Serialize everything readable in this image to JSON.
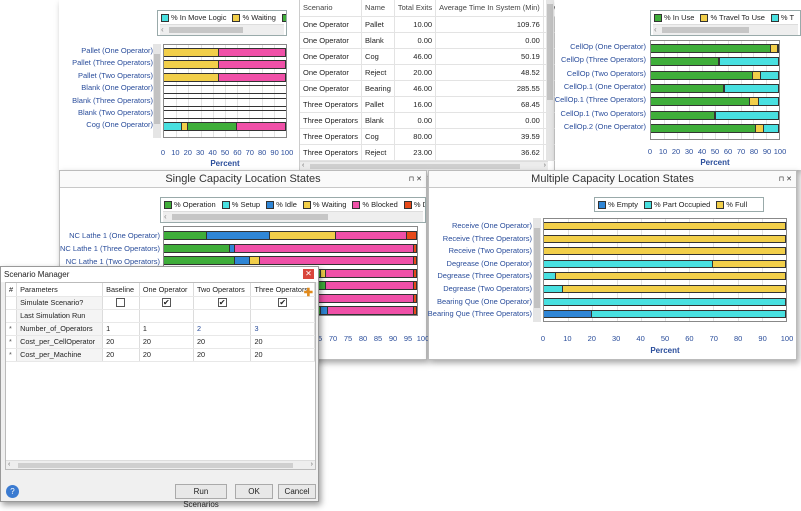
{
  "top_left": {
    "legend": [
      {
        "label": "% In Move Logic",
        "color": "#48e0e0"
      },
      {
        "label": "% Waiting",
        "color": "#f2cf4a"
      },
      {
        "label": "",
        "color": "#3fae3a"
      }
    ],
    "categories": [
      "Pallet (One Operator)",
      "Pallet (Three Operators)",
      "Pallet (Two Operators)",
      "Blank (One Operator)",
      "Blank (Three Operators)",
      "Blank (Two Operators)",
      "Cog (One Operator)"
    ],
    "x_ticks": [
      "0",
      "10",
      "20",
      "30",
      "40",
      "50",
      "60",
      "70",
      "80",
      "90",
      "100"
    ],
    "xlabel": "Percent"
  },
  "table": {
    "headers": [
      "Scenario",
      "Name",
      "Total Exits",
      "Average Time In System (Min)",
      "Average"
    ],
    "rows": [
      [
        "One Operator",
        "Pallet",
        "10.00",
        "109.76"
      ],
      [
        "One Operator",
        "Blank",
        "0.00",
        "0.00"
      ],
      [
        "One Operator",
        "Cog",
        "46.00",
        "50.19"
      ],
      [
        "One Operator",
        "Reject",
        "20.00",
        "48.52"
      ],
      [
        "One Operator",
        "Bearing",
        "46.00",
        "285.55"
      ],
      [
        "Three Operators",
        "Pallet",
        "16.00",
        "68.45"
      ],
      [
        "Three Operators",
        "Blank",
        "0.00",
        "0.00"
      ],
      [
        "Three Operators",
        "Cog",
        "80.00",
        "39.59"
      ],
      [
        "Three Operators",
        "Reject",
        "23.00",
        "36.62"
      ],
      [
        "Three Operators",
        "Bearing",
        "79.00",
        "37.92"
      ]
    ]
  },
  "top_right": {
    "legend": [
      {
        "label": "% In Use",
        "color": "#3fae3a"
      },
      {
        "label": "% Travel To Use",
        "color": "#f2cf4a"
      },
      {
        "label": "% T",
        "color": "#48e0e0"
      }
    ],
    "categories": [
      "CellOp (One Operator)",
      "CellOp (Three Operators)",
      "CellOp (Two Operators)",
      "CellOp.1 (One Operator)",
      "CellOp.1 (Three Operators)",
      "CellOp.1 (Two Operators)",
      "CellOp.2 (One Operator)"
    ],
    "x_ticks": [
      "0",
      "10",
      "20",
      "30",
      "40",
      "50",
      "60",
      "70",
      "80",
      "90",
      "100"
    ],
    "xlabel": "Percent"
  },
  "single": {
    "title": "Single Capacity Location States",
    "controls": "⊓ ✕",
    "legend": [
      {
        "label": "% Operation",
        "color": "#3fae3a"
      },
      {
        "label": "% Setup",
        "color": "#48e0e0"
      },
      {
        "label": "% Idle",
        "color": "#2f86d6"
      },
      {
        "label": "% Waiting",
        "color": "#f2cf4a"
      },
      {
        "label": "% Blocked",
        "color": "#f050a8"
      },
      {
        "label": "% Do",
        "color": "#e84a1a"
      }
    ],
    "categories": [
      "NC Lathe 1 (One Operator)",
      "NC Lathe 1 (Three Operators)",
      "NC Lathe 1 (Two Operators)"
    ],
    "x_ticks": [
      "65",
      "70",
      "75",
      "80",
      "85",
      "90",
      "95",
      "100"
    ]
  },
  "multi": {
    "title": "Multiple Capacity Location States",
    "controls": "⊓ ✕",
    "legend": [
      {
        "label": "% Empty",
        "color": "#2f86d6"
      },
      {
        "label": "% Part Occupied",
        "color": "#48e0e0"
      },
      {
        "label": "% Full",
        "color": "#f2cf4a"
      }
    ],
    "categories": [
      "Receive (One Operator)",
      "Receive (Three Operators)",
      "Receive (Two Operators)",
      "Degrease (One Operator)",
      "Degrease (Three Operators)",
      "Degrease (Two Operators)",
      "Bearing Que (One Operator)",
      "Bearing Que (Three Operators)"
    ],
    "x_ticks": [
      "0",
      "10",
      "20",
      "30",
      "40",
      "50",
      "60",
      "70",
      "80",
      "90",
      "100"
    ],
    "xlabel": "Percent"
  },
  "dialog": {
    "title": "Scenario Manager",
    "columns": [
      "#",
      "Parameters",
      "Baseline",
      "One Operator",
      "Two Operators",
      "Three Operators"
    ],
    "rows": [
      {
        "mark": "",
        "param": "Simulate Scenario?",
        "baseline": "",
        "one": "✔",
        "two": "✔",
        "three": "✔"
      },
      {
        "mark": "",
        "param": "Last Simulation Run",
        "baseline": "",
        "one": "",
        "two": "",
        "three": ""
      },
      {
        "mark": "*",
        "param": "Number_of_Operators",
        "baseline": "1",
        "one": "1",
        "two": "2",
        "three": "3"
      },
      {
        "mark": "*",
        "param": "Cost_per_CellOperator",
        "baseline": "20",
        "one": "20",
        "two": "20",
        "three": "20"
      },
      {
        "mark": "*",
        "param": "Cost_per_Machine",
        "baseline": "20",
        "one": "20",
        "two": "20",
        "three": "20"
      }
    ],
    "buttons": {
      "run": "Run Scenarios",
      "ok": "OK",
      "cancel": "Cancel"
    }
  },
  "chart_data": [
    {
      "type": "bar",
      "stacked": true,
      "orientation": "horizontal",
      "categories": [
        "Pallet (One Operator)",
        "Pallet (Three Operators)",
        "Pallet (Two Operators)",
        "Blank (One Operator)",
        "Blank (Three Operators)",
        "Blank (Two Operators)",
        "Cog (One Operator)"
      ],
      "series": [
        {
          "name": "% In Move Logic",
          "values": [
            0,
            0,
            0,
            0,
            0,
            0,
            15
          ]
        },
        {
          "name": "% Waiting",
          "values": [
            45,
            45,
            45,
            0,
            0,
            0,
            5
          ]
        },
        {
          "name": "",
          "values": [
            0,
            0,
            0,
            0,
            0,
            0,
            40
          ]
        },
        {
          "values": [
            55,
            55,
            55,
            0,
            0,
            0,
            40
          ]
        }
      ],
      "xlabel": "Percent",
      "xlim": [
        0,
        100
      ]
    },
    {
      "type": "bar",
      "stacked": true,
      "orientation": "horizontal",
      "categories": [
        "CellOp (One Operator)",
        "CellOp (Three Operators)",
        "CellOp (Two Operators)",
        "CellOp.1 (One Operator)",
        "CellOp.1 (Three Operators)",
        "CellOp.1 (Two Operators)",
        "CellOp.2 (One Operator)"
      ],
      "series": [
        {
          "name": "% In Use",
          "values": [
            94,
            53,
            80,
            57,
            77,
            50,
            82
          ]
        },
        {
          "name": "% Travel To Use",
          "values": [
            5,
            1,
            6,
            1,
            7,
            1,
            6
          ]
        },
        {
          "name": "% T",
          "values": [
            1,
            46,
            14,
            42,
            16,
            49,
            12
          ]
        }
      ],
      "xlabel": "Percent",
      "xlim": [
        0,
        100
      ]
    },
    {
      "type": "bar",
      "stacked": true,
      "orientation": "horizontal",
      "categories": [
        "Receive (One Operator)",
        "Receive (Three Operators)",
        "Receive (Two Operators)",
        "Degrease (One Operator)",
        "Degrease (Three Operators)",
        "Degrease (Two Operators)",
        "Bearing Que (One Operator)",
        "Bearing Que (Three Operators)"
      ],
      "series": [
        {
          "name": "% Empty",
          "values": [
            0,
            0,
            0,
            0,
            0,
            0,
            0,
            20
          ]
        },
        {
          "name": "% Part Occupied",
          "values": [
            0,
            0,
            0,
            70,
            5,
            8,
            100,
            80
          ]
        },
        {
          "name": "% Full",
          "values": [
            100,
            100,
            100,
            30,
            95,
            92,
            0,
            0
          ]
        }
      ],
      "xlabel": "Percent",
      "xlim": [
        0,
        100
      ]
    }
  ]
}
